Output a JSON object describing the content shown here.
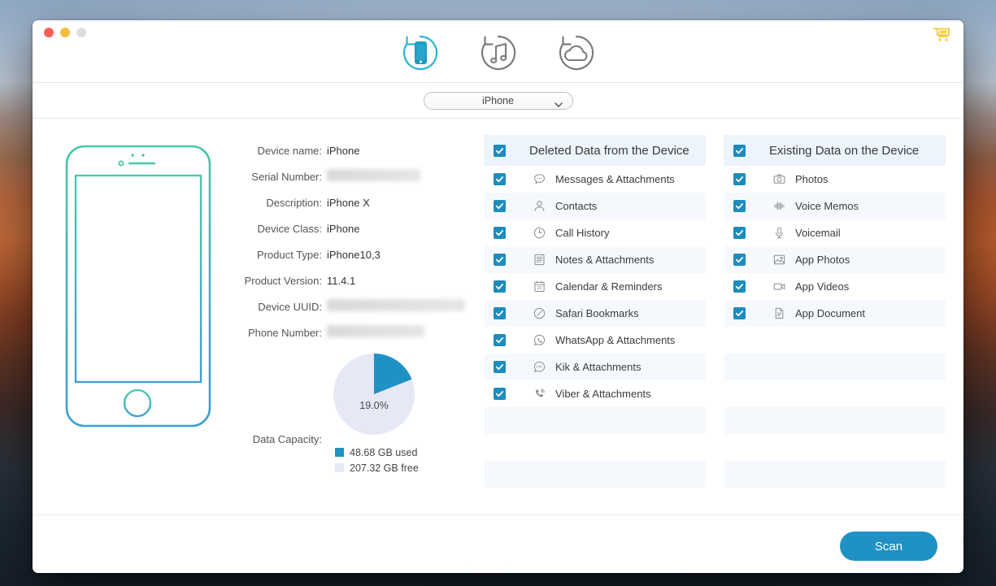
{
  "window": {
    "traffic_lights": [
      "close",
      "minimize",
      "zoom"
    ],
    "cart_icon": "shopping-cart-icon"
  },
  "toolbar": {
    "modes": [
      {
        "id": "recover-from-device",
        "icon": "phone-restore-icon",
        "active": true
      },
      {
        "id": "recover-from-itunes",
        "icon": "itunes-restore-icon",
        "active": false
      },
      {
        "id": "recover-from-icloud",
        "icon": "icloud-restore-icon",
        "active": false
      }
    ]
  },
  "device_select": {
    "value": "iPhone",
    "icon": "chevron-down-icon"
  },
  "device_info": {
    "rows": [
      {
        "label": "Device name:",
        "value": "iPhone",
        "redacted": false
      },
      {
        "label": "Serial Number:",
        "value": "",
        "redacted": true,
        "redact_width": 115
      },
      {
        "label": "Description:",
        "value": "iPhone X",
        "redacted": false
      },
      {
        "label": "Device Class:",
        "value": "iPhone",
        "redacted": false
      },
      {
        "label": "Product Type:",
        "value": "iPhone10,3",
        "redacted": false
      },
      {
        "label": "Product Version:",
        "value": "11.4.1",
        "redacted": false
      },
      {
        "label": "Device UUID:",
        "value": "",
        "redacted": true,
        "redact_width": 170
      },
      {
        "label": "Phone Number:",
        "value": "",
        "redacted": true,
        "redact_width": 120
      }
    ]
  },
  "capacity": {
    "label": "Data Capacity:",
    "percent_label": "19.0%",
    "used_label": "48.68 GB used",
    "free_label": "207.32 GB free",
    "used_color": "#1f91c4",
    "free_color": "#e7e8f5"
  },
  "chart_data": {
    "type": "pie",
    "title": "Data Capacity",
    "categories": [
      "used",
      "free"
    ],
    "values": [
      48.68,
      207.32
    ],
    "unit": "GB",
    "percentages": [
      19.0,
      81.0
    ],
    "labels": [
      "48.68 GB used",
      "207.32 GB free"
    ],
    "colors": [
      "#1f91c4",
      "#e7e8f5"
    ],
    "center_label": "19.0%",
    "start_angle_deg": 0,
    "direction": "clockwise",
    "legend": "bottom"
  },
  "lists": [
    {
      "id": "deleted-data",
      "header": {
        "label": "Deleted Data from the Device",
        "checked": true
      },
      "items": [
        {
          "label": "Messages & Attachments",
          "icon": "message-bubble-icon",
          "checked": true
        },
        {
          "label": "Contacts",
          "icon": "contact-person-icon",
          "checked": true
        },
        {
          "label": "Call History",
          "icon": "clock-icon",
          "checked": true
        },
        {
          "label": "Notes & Attachments",
          "icon": "notes-lines-icon",
          "checked": true
        },
        {
          "label": "Calendar & Reminders",
          "icon": "calendar-icon",
          "checked": true
        },
        {
          "label": "Safari Bookmarks",
          "icon": "safari-compass-icon",
          "checked": true
        },
        {
          "label": "WhatsApp & Attachments",
          "icon": "whatsapp-icon",
          "checked": true
        },
        {
          "label": "Kik & Attachments",
          "icon": "kik-icon",
          "checked": true
        },
        {
          "label": "Viber & Attachments",
          "icon": "viber-icon",
          "checked": true
        }
      ],
      "empty_rows": 4
    },
    {
      "id": "existing-data",
      "header": {
        "label": "Existing Data on the Device",
        "checked": true
      },
      "items": [
        {
          "label": "Photos",
          "icon": "camera-icon",
          "checked": true
        },
        {
          "label": "Voice Memos",
          "icon": "waveform-icon",
          "checked": true
        },
        {
          "label": "Voicemail",
          "icon": "microphone-icon",
          "checked": true
        },
        {
          "label": "App Photos",
          "icon": "image-icon",
          "checked": true
        },
        {
          "label": "App Videos",
          "icon": "video-camera-icon",
          "checked": true
        },
        {
          "label": "App Document",
          "icon": "document-icon",
          "checked": true
        }
      ],
      "empty_rows": 7
    }
  ],
  "footer": {
    "scan_label": "Scan"
  }
}
